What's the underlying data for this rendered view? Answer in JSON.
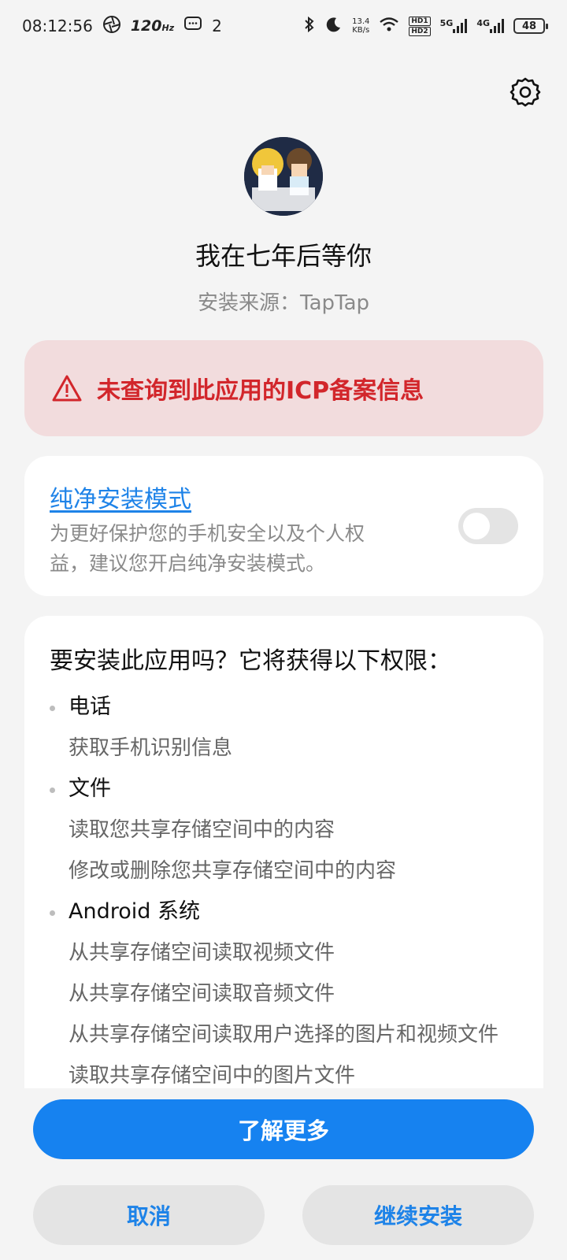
{
  "status_bar": {
    "time": "08:12:56",
    "refresh_rate": "120",
    "refresh_unit": "Hz",
    "notification_count": "2",
    "speed_value": "13.4",
    "speed_unit": "KB/s",
    "hd1": "HD1",
    "hd2": "HD2",
    "net_5g": "5G",
    "net_4g": "4G",
    "battery": "48"
  },
  "app": {
    "name": "我在七年后等你",
    "install_source": "安装来源：TapTap"
  },
  "warning": {
    "text": "未查询到此应用的ICP备案信息"
  },
  "pure_mode": {
    "title": "纯净安装模式",
    "description": "为更好保护您的手机安全以及个人权益，建议您开启纯净安装模式。",
    "enabled": false
  },
  "permissions": {
    "heading": "要安装此应用吗？它将获得以下权限：",
    "groups": [
      {
        "title": "电话",
        "items": [
          "获取手机识别信息"
        ]
      },
      {
        "title": "文件",
        "items": [
          "读取您共享存储空间中的内容",
          "修改或删除您共享存储空间中的内容"
        ]
      },
      {
        "title": "Android 系统",
        "items": [
          "从共享存储空间读取视频文件",
          "从共享存储空间读取音频文件",
          "从共享存储空间读取用户选择的图片和视频文件",
          "读取共享存储空间中的图片文件"
        ]
      }
    ]
  },
  "buttons": {
    "learn_more": "了解更多",
    "cancel": "取消",
    "continue": "继续安装"
  },
  "colors": {
    "accent": "#1682f0",
    "warning_red": "#d2262b",
    "warning_bg": "#f2dcdd"
  }
}
